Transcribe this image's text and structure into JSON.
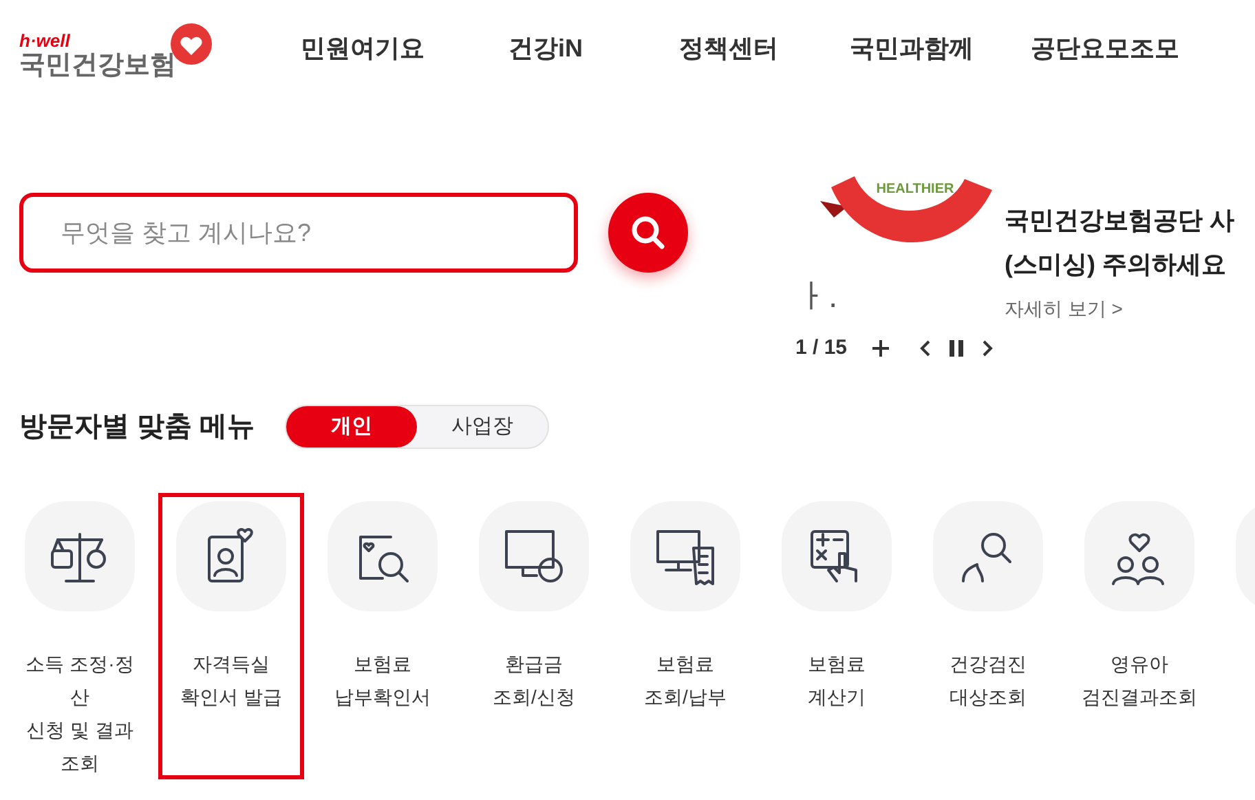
{
  "logo": {
    "tagline": "h·well",
    "name": "국민건강보험"
  },
  "nav": [
    "민원여기요",
    "건강iN",
    "정책센터",
    "국민과함께",
    "공단요모조모"
  ],
  "search": {
    "placeholder": "무엇을 찾고 계시나요?"
  },
  "banner": {
    "graphic_text": "HEALTHIER",
    "fragment": "ㅏ.",
    "title_lines": [
      "국민건강보험공단 사",
      "(스미싱) 주의하세요"
    ],
    "more": "자세히 보기 >",
    "pager": "1 / 15"
  },
  "section": {
    "title": "방문자별 맞춤 메뉴",
    "tabs": [
      {
        "label": "개인",
        "selected": true
      },
      {
        "label": "사업장",
        "selected": false
      }
    ]
  },
  "quick_menu": [
    {
      "kind": "scale",
      "lines": [
        "소득 조정·정",
        "산",
        "신청 및 결과",
        "조회"
      ],
      "highlighted": false
    },
    {
      "kind": "id-card",
      "lines": [
        "자격득실",
        "확인서 발급"
      ],
      "highlighted": true
    },
    {
      "kind": "doc-search",
      "lines": [
        "보험료",
        "납부확인서"
      ],
      "highlighted": false
    },
    {
      "kind": "monitor",
      "lines": [
        "환급금",
        "조회/신청"
      ],
      "highlighted": false
    },
    {
      "kind": "receipt",
      "lines": [
        "보험료",
        "조회/납부"
      ],
      "highlighted": false
    },
    {
      "kind": "calculator",
      "lines": [
        "보험료",
        "계산기"
      ],
      "highlighted": false
    },
    {
      "kind": "people-search",
      "lines": [
        "건강검진",
        "대상조회"
      ],
      "highlighted": false
    },
    {
      "kind": "family",
      "lines": [
        "영유아",
        "검진결과조회"
      ],
      "highlighted": false
    },
    {
      "kind": "blank",
      "highlighted": false
    }
  ]
}
